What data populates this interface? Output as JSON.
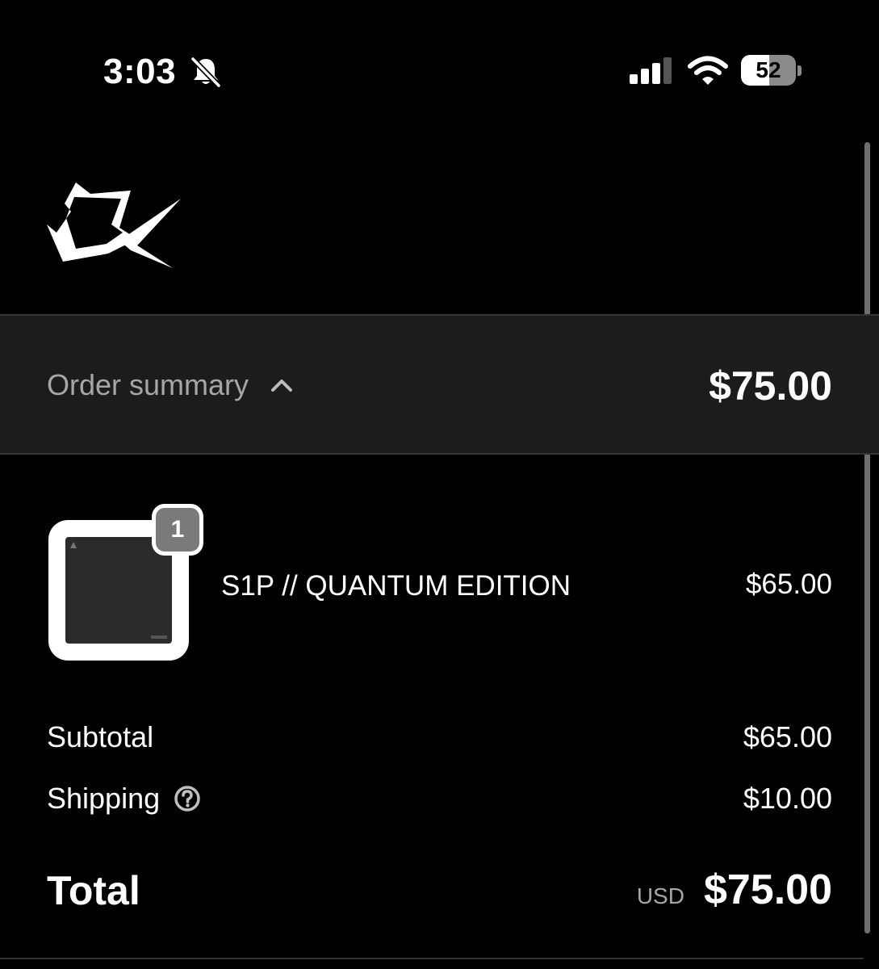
{
  "status_bar": {
    "time": "3:03",
    "battery_level": "52",
    "battery_fraction": 0.52,
    "silent_icon": "bell-slash-icon",
    "signal_icon": "cellular-signal-icon",
    "wifi_icon": "wifi-icon"
  },
  "brand": {
    "logo_icon": "brand-logo-icon"
  },
  "order_summary": {
    "label": "Order summary",
    "toggle_icon": "chevron-up-icon",
    "total": "$75.00"
  },
  "line_items": [
    {
      "quantity": "1",
      "name": "S1P // QUANTUM EDITION",
      "price": "$65.00"
    }
  ],
  "totals": {
    "subtotal_label": "Subtotal",
    "subtotal_value": "$65.00",
    "shipping_label": "Shipping",
    "shipping_help_icon": "question-circle-icon",
    "shipping_value": "$10.00",
    "total_label": "Total",
    "currency": "USD",
    "total_value": "$75.00"
  },
  "colors": {
    "background": "#000000",
    "summary_bar": "#1c1c1c",
    "muted_text": "#a6a6a6",
    "text": "#ffffff"
  }
}
